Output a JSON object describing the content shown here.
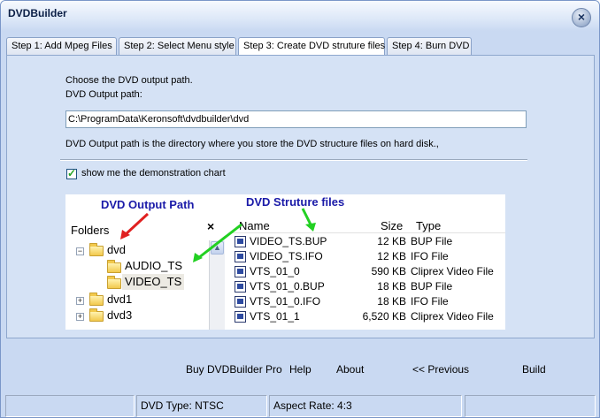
{
  "window": {
    "title": "DVDBuilder",
    "close_glyph": "×"
  },
  "tabs": [
    {
      "label": "Step 1: Add Mpeg Files",
      "active": false
    },
    {
      "label": "Step 2: Select Menu style",
      "active": false
    },
    {
      "label": "Step 3: Create DVD struture files",
      "active": true
    },
    {
      "label": "Step 4: Burn DVD",
      "active": false
    }
  ],
  "panel": {
    "choose_text": "Choose the DVD output path.",
    "path_label": "DVD Output path:",
    "path_value": "C:\\ProgramData\\Keronsoft\\dvdbuilder\\dvd",
    "description": "DVD Output path is the directory where you store the DVD structure files on hard disk.,",
    "show_chart_label": "show me the demonstration chart",
    "show_chart_checked": true
  },
  "chart": {
    "annotation_output_path": "DVD Output Path",
    "annotation_structure_files": "DVD Struture files",
    "annotation_color": "#1a1aa8",
    "folders_header": "Folders",
    "folders_close_glyph": "×",
    "scroll_up_glyph": "▲",
    "tree": [
      {
        "label": "dvd",
        "expander": "−"
      },
      {
        "label": "AUDIO_TS"
      },
      {
        "label": "VIDEO_TS",
        "selected": true
      },
      {
        "label": "dvd1",
        "expander": "+"
      },
      {
        "label": "dvd3",
        "expander": "+"
      }
    ],
    "columns": {
      "name": "Name",
      "size": "Size",
      "type": "Type"
    },
    "files": [
      {
        "name": "VIDEO_TS.BUP",
        "size": "12 KB",
        "type": "BUP File"
      },
      {
        "name": "VIDEO_TS.IFO",
        "size": "12 KB",
        "type": "IFO File"
      },
      {
        "name": "VTS_01_0",
        "size": "590 KB",
        "type": "Cliprex Video File"
      },
      {
        "name": "VTS_01_0.BUP",
        "size": "18 KB",
        "type": "BUP File"
      },
      {
        "name": "VTS_01_0.IFO",
        "size": "18 KB",
        "type": "IFO File"
      },
      {
        "name": "VTS_01_1",
        "size": "6,520 KB",
        "type": "Cliprex Video File"
      }
    ]
  },
  "bottom_buttons": {
    "buy": "Buy DVDBuilder Pro",
    "help": "Help",
    "about": "About",
    "previous": "<< Previous",
    "build": "Build"
  },
  "statusbar": {
    "dvd_type": "DVD Type: NTSC",
    "aspect_rate": "Aspect Rate: 4:3"
  },
  "colors": {
    "red_arrow": "#e02020",
    "green_arrow": "#22d022"
  }
}
